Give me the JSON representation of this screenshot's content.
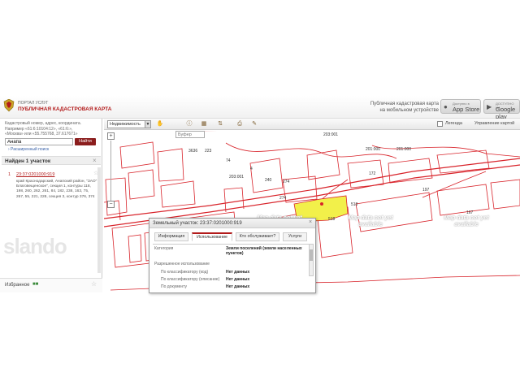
{
  "header": {
    "portal_label": "ПОРТАЛ УСЛУГ",
    "title": "ПУБЛИЧНАЯ КАДАСТРОВАЯ КАРТА",
    "mobile_text_1": "Публичная кадастровая карта",
    "mobile_text_2": "на мобильном устройстве",
    "appstore_small": "Доступно в",
    "appstore_big": "App Store",
    "gplay_small": "ДОСТУПНО НА",
    "gplay_big": "Google play"
  },
  "sidebar": {
    "search_hint_1": "Кадастровый номер, адрес, координата.",
    "search_hint_2": "Например «61:6:10104:12», «61:6:»,",
    "search_hint_3": "«Москва» или «55.755768, 37.617671»",
    "search_value": "Анапа",
    "find_label": "Найти",
    "advanced_search": "› Расширенный поиск",
    "found_label": "Найден 1 участок",
    "found_close": "×",
    "result_number": "1",
    "result_id": "23:37:0201000:919",
    "result_address": "край Краснодарский, Анапский район, \"ЗАО\" Благовещенское\", секция 1, контуры 118, 198, 260, 262, 261, 84, 182, 238, 163, 75, 267, 55, 221, 228, секция 3, контур 376, 374",
    "favorites_label": "Избранное"
  },
  "toolbar": {
    "layer_select": "Недвижимость",
    "buffer_placeholder": "Буфер",
    "legend_label": "Легенда",
    "manage_label": "Управление картой"
  },
  "map": {
    "parcel_labels": [
      "3636",
      "223",
      "203:001",
      "518",
      "203:001",
      "201:000",
      "172",
      "274",
      "240",
      "274",
      "518",
      "167",
      "197",
      "4",
      "74",
      "201:000"
    ],
    "nodata_text": "Map data not yet available",
    "accent_red": "#d8232a",
    "highlight_yellow": "#f2f04a"
  },
  "popup": {
    "title": "Земельный участок: 23:37:0201000:919",
    "close": "×",
    "tabs": [
      "Информация",
      "Использование",
      "Кто обслуживает?",
      "Услуги"
    ],
    "rows": [
      {
        "key": "Категория",
        "value": "Земли поселений (земли населенных пунктов)"
      },
      {
        "key": "Разрешенное использование",
        "value": ""
      },
      {
        "key": "По классификатору (код)",
        "value": "Нет данных"
      },
      {
        "key": "По классификатору (описание)",
        "value": "Нет данных"
      },
      {
        "key": "По документу",
        "value": "Нет данных"
      }
    ]
  },
  "watermark": "slando"
}
